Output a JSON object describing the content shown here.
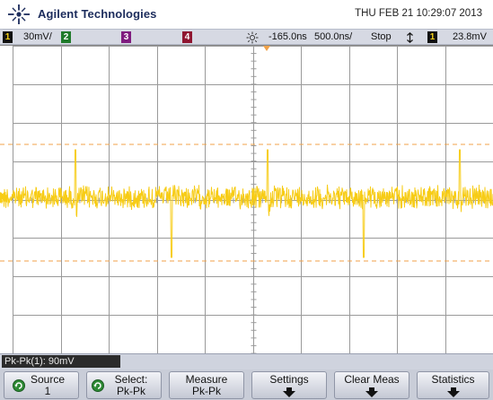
{
  "header": {
    "brand": "Agilent Technologies",
    "datetime": "THU FEB 21 10:29:07 2013"
  },
  "status_bar": {
    "channels": [
      {
        "number": "1",
        "scale": "30mV/",
        "color": "#d4b800"
      },
      {
        "number": "2",
        "scale": "",
        "color": "#2fa03a"
      },
      {
        "number": "3",
        "scale": "",
        "color": "#b12ab1"
      },
      {
        "number": "4",
        "scale": "",
        "color": "#d3203f"
      }
    ],
    "delay": "-165.0ns",
    "timebase": "500.0ns/",
    "run_state": "Stop",
    "trigger_channel": "1",
    "trigger_level": "23.8mV"
  },
  "scope": {
    "trace_color": "#f7cc16",
    "cursor_color": "#f0a24a",
    "trigger_marker_color": "#f0a24a",
    "grid_color": "#909090"
  },
  "measurement": {
    "readout": "Pk-Pk(1): 90mV"
  },
  "softkeys": {
    "source": {
      "line1": "Source",
      "line2": "1"
    },
    "select": {
      "line1": "Select:",
      "line2": "Pk-Pk"
    },
    "measure": {
      "line1": "Measure",
      "line2": "Pk-Pk"
    },
    "settings": {
      "line1": "Settings"
    },
    "clear_meas": {
      "line1": "Clear Meas"
    },
    "statistics": {
      "line1": "Statistics"
    }
  }
}
